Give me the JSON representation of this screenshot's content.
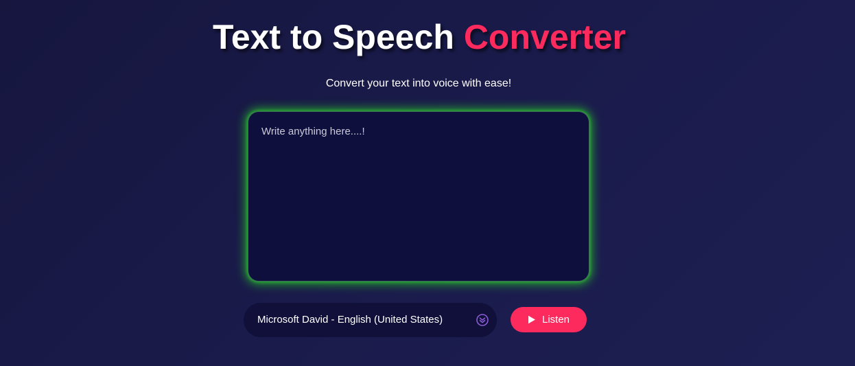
{
  "header": {
    "title_main": "Text to Speech",
    "title_accent": "Converter",
    "subtitle": "Convert your text into voice with ease!"
  },
  "editor": {
    "placeholder": "Write anything here....!",
    "value": ""
  },
  "controls": {
    "voice_selected": "Microsoft David - English (United States)",
    "listen_label": "Listen"
  },
  "icons": {
    "dropdown": "chevron-double-down-icon",
    "play": "play-icon"
  },
  "colors": {
    "background": "#1b1c4d",
    "accent": "#fd2a5e",
    "panel": "#0f0f3e",
    "glow": "#28c828",
    "select_icon": "#8a5cd6"
  }
}
